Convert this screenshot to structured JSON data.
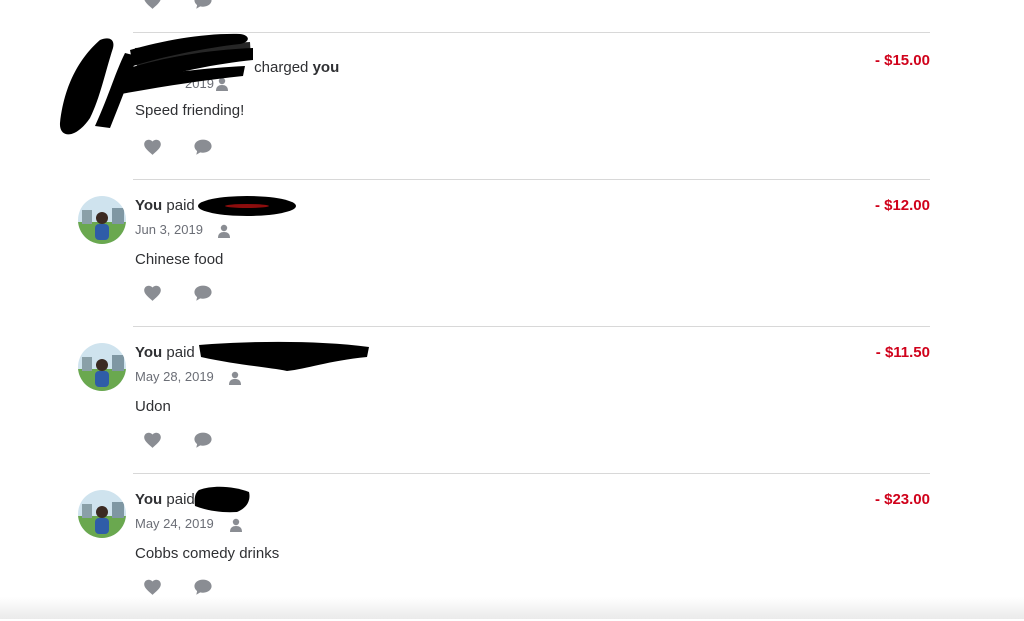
{
  "colors": {
    "debit": "#d0021b",
    "icon": "#8a8d93",
    "divider": "#d8d8d8",
    "redaction": "#000000"
  },
  "transactions": [
    {
      "actor": "",
      "verb": "charged",
      "target": "you",
      "amount": "- $15.00",
      "date": "2019",
      "note": "Speed friending!"
    },
    {
      "actor": "You",
      "verb": "paid",
      "target": "",
      "amount": "- $12.00",
      "date": "Jun 3, 2019",
      "note": "Chinese food"
    },
    {
      "actor": "You",
      "verb": "paid",
      "target": "",
      "amount": "- $11.50",
      "date": "May 28, 2019",
      "note": "Udon"
    },
    {
      "actor": "You",
      "verb": "paid",
      "target": "",
      "amount": "- $23.00",
      "date": "May 24, 2019",
      "note": "Cobbs comedy drinks"
    }
  ],
  "icons": {
    "like": "heart-icon",
    "comment": "comment-icon",
    "privacy": "person-icon"
  }
}
